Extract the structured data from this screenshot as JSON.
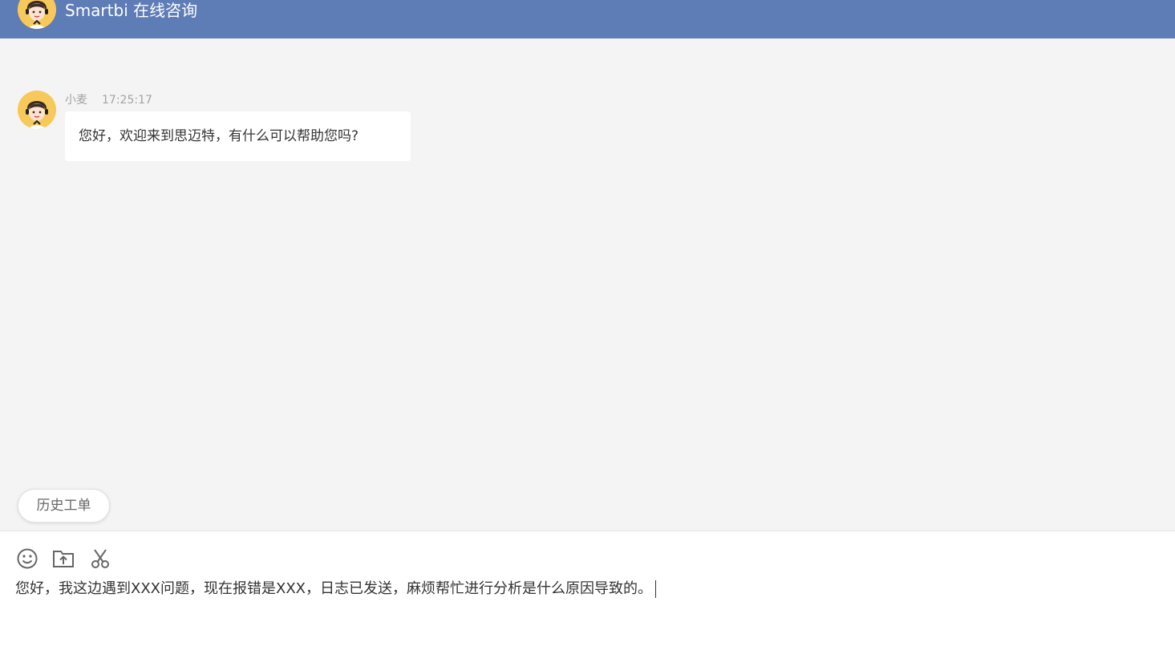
{
  "header": {
    "title": "Smartbi 在线咨询",
    "avatar_icon": "agent-avatar-icon"
  },
  "conversation": {
    "messages": [
      {
        "sender": "小麦",
        "time": "17:25:17",
        "text": "您好，欢迎来到思迈特，有什么可以帮助您吗?"
      }
    ]
  },
  "history_button": {
    "label": "历史工单"
  },
  "toolbar": {
    "icons": [
      "emoji-icon",
      "upload-folder-icon",
      "scissors-icon"
    ]
  },
  "composer": {
    "value": "您好，我这边遇到XXX问题，现在报错是XXX，日志已发送，麻烦帮忙进行分析是什么原因导致的。"
  },
  "colors": {
    "header_bg": "#5e7cb6",
    "chat_bg": "#f4f4f4",
    "avatar_bg": "#f7c95a"
  }
}
